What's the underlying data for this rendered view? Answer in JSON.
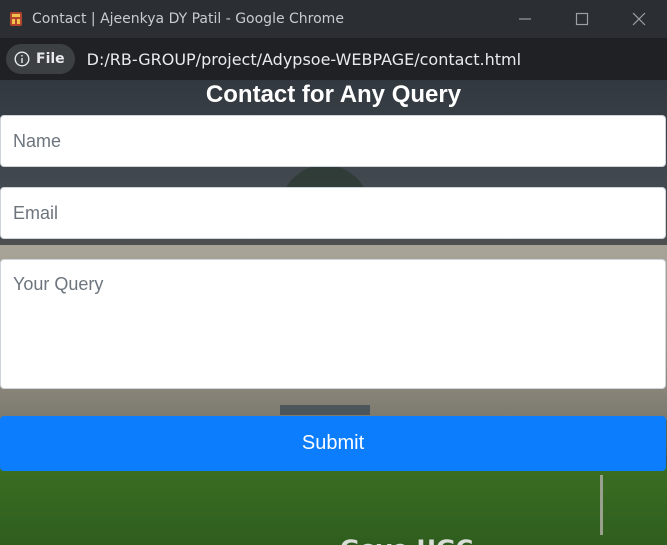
{
  "window": {
    "title": "Contact | Ajeenkya DY Patil - Google Chrome"
  },
  "address_bar": {
    "chip_label": "File",
    "url": "D:/RB-GROUP/project/Adypsoe-WEBPAGE/contact.html"
  },
  "page": {
    "heading": "Contact for Any Query",
    "form": {
      "name_placeholder": "Name",
      "email_placeholder": "Email",
      "query_placeholder": "Your Query",
      "submit_label": "Submit"
    },
    "background_partial_text": "Gove UGC"
  },
  "colors": {
    "submit_bg": "#0b7dfd",
    "titlebar_bg": "#2b2e33",
    "addressbar_bg": "#202124"
  }
}
